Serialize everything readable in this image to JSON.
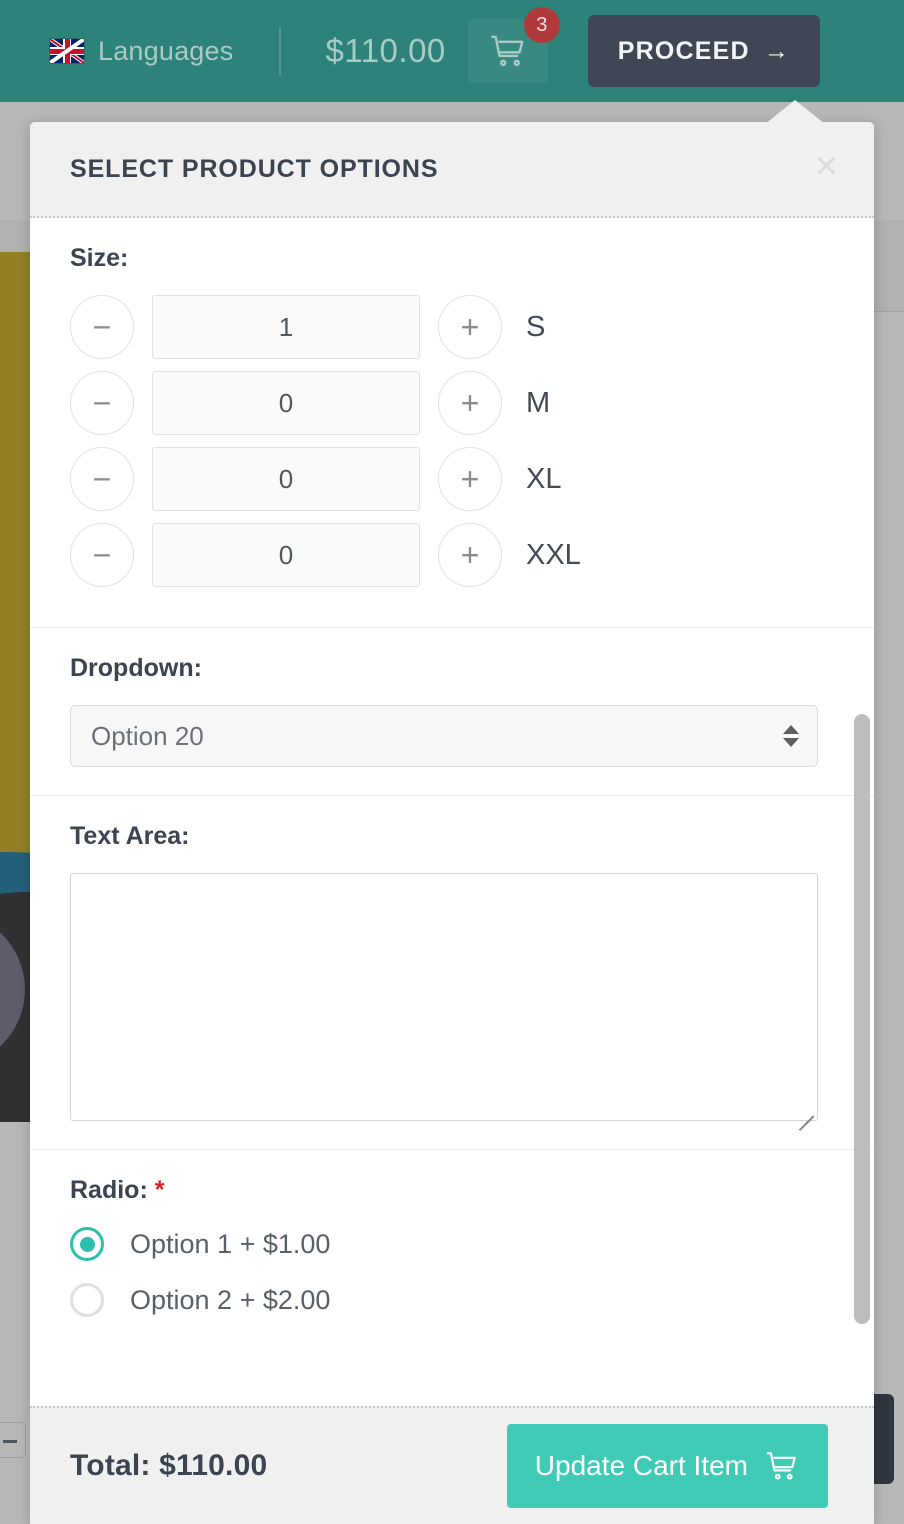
{
  "topbar": {
    "language_label": "Languages",
    "flag_icon": "uk-flag-icon",
    "cart_total": "$110.00",
    "cart_icon": "shopping-cart-icon",
    "cart_count": "3",
    "proceed_label": "PROCEED",
    "proceed_arrow": "→",
    "background_color": "#2d8379",
    "proceed_bg": "#3f4654",
    "badge_color": "#b03a3a"
  },
  "modal": {
    "title": "SELECT PRODUCT OPTIONS",
    "close_icon": "close-icon",
    "close_glyph": "×",
    "sections": {
      "size": {
        "label": "Size:",
        "minus_glyph": "−",
        "plus_glyph": "+",
        "rows": [
          {
            "qty": "1",
            "size": "S"
          },
          {
            "qty": "0",
            "size": "M"
          },
          {
            "qty": "0",
            "size": "XL"
          },
          {
            "qty": "0",
            "size": "XXL"
          }
        ]
      },
      "dropdown": {
        "label": "Dropdown:",
        "selected": "Option 20"
      },
      "textarea": {
        "label": "Text Area:",
        "value": "",
        "placeholder": ""
      },
      "radio": {
        "label": "Radio:",
        "required_mark": "*",
        "options": [
          {
            "label": "Option 1 + $1.00",
            "selected": true
          },
          {
            "label": "Option 2 + $2.00",
            "selected": false
          }
        ]
      }
    },
    "footer": {
      "total_label": "Total: $110.00",
      "update_label": "Update Cart Item",
      "update_icon": "shopping-cart-icon",
      "update_bg": "#3fcbb6"
    }
  }
}
